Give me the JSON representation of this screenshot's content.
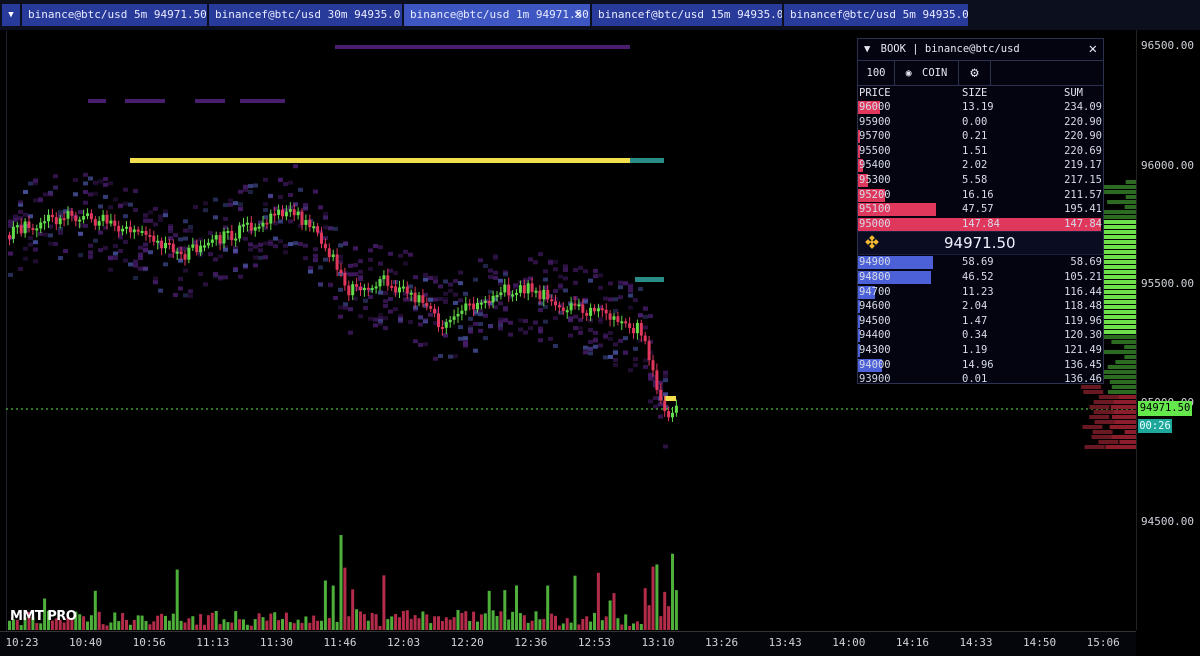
{
  "tabs": [
    {
      "label": "binance@btc/usd 5m 94971.50"
    },
    {
      "label": "binancef@btc/usd 30m 94935.0"
    },
    {
      "label": "binance@btc/usd 1m 94971.50"
    },
    {
      "label": "binancef@btc/usd 15m 94935.0"
    },
    {
      "label": "binancef@btc/usd 5m 94935.0"
    }
  ],
  "tab_close_icon": "close-icon",
  "price_axis": [
    "96500.00",
    "96000.00",
    "95500.00",
    "95000.00",
    "94500.00"
  ],
  "time_axis": [
    "10:23",
    "10:40",
    "10:56",
    "11:13",
    "11:30",
    "11:46",
    "12:03",
    "12:20",
    "12:36",
    "12:53",
    "13:10",
    "13:26",
    "13:43",
    "14:00",
    "14:16",
    "14:33",
    "14:50",
    "15:06"
  ],
  "current_price": "94971.50",
  "candle_timer": "00:26",
  "brand": "MMT PRO",
  "book": {
    "title": "BOOK | binance@btc/usd",
    "depth": "100",
    "unit": "COIN",
    "headers": {
      "price": "PRICE",
      "size": "SIZE",
      "sum": "SUM"
    },
    "mid_price": "94971.50",
    "asks": [
      {
        "price": "96000",
        "size": "13.19",
        "sum": "234.09",
        "fill": 0.09
      },
      {
        "price": "95900",
        "size": "0.00",
        "sum": "220.90",
        "fill": 0
      },
      {
        "price": "95700",
        "size": "0.21",
        "sum": "220.90",
        "fill": 0.01
      },
      {
        "price": "95500",
        "size": "1.51",
        "sum": "220.69",
        "fill": 0.01
      },
      {
        "price": "95400",
        "size": "2.02",
        "sum": "219.17",
        "fill": 0.02
      },
      {
        "price": "95300",
        "size": "5.58",
        "sum": "217.15",
        "fill": 0.04
      },
      {
        "price": "95200",
        "size": "16.16",
        "sum": "211.57",
        "fill": 0.11
      },
      {
        "price": "95100",
        "size": "47.57",
        "sum": "195.41",
        "fill": 0.32
      },
      {
        "price": "95000",
        "size": "147.84",
        "sum": "147.84",
        "fill": 1.0
      }
    ],
    "bids": [
      {
        "price": "94900",
        "size": "58.69",
        "sum": "58.69",
        "fill": 0.31
      },
      {
        "price": "94800",
        "size": "46.52",
        "sum": "105.21",
        "fill": 0.3
      },
      {
        "price": "94700",
        "size": "11.23",
        "sum": "116.44",
        "fill": 0.07
      },
      {
        "price": "94600",
        "size": "2.04",
        "sum": "118.48",
        "fill": 0.01
      },
      {
        "price": "94500",
        "size": "1.47",
        "sum": "119.96",
        "fill": 0.01
      },
      {
        "price": "94400",
        "size": "0.34",
        "sum": "120.30",
        "fill": 0.01
      },
      {
        "price": "94300",
        "size": "1.19",
        "sum": "121.49",
        "fill": 0.01
      },
      {
        "price": "94000",
        "size": "14.96",
        "sum": "136.45",
        "fill": 0.1
      },
      {
        "price": "93900",
        "size": "0.01",
        "sum": "136.46",
        "fill": 0
      }
    ]
  },
  "colors": {
    "ask": "#e0375d",
    "bid": "#4c61d8",
    "up": "#62dc4a",
    "down": "#e0375d",
    "current": "#64e84c",
    "wall": "#f3de4e",
    "heat": "#4a1d6e",
    "tab": "#283a9a",
    "tab_active": "#3e56c2"
  }
}
